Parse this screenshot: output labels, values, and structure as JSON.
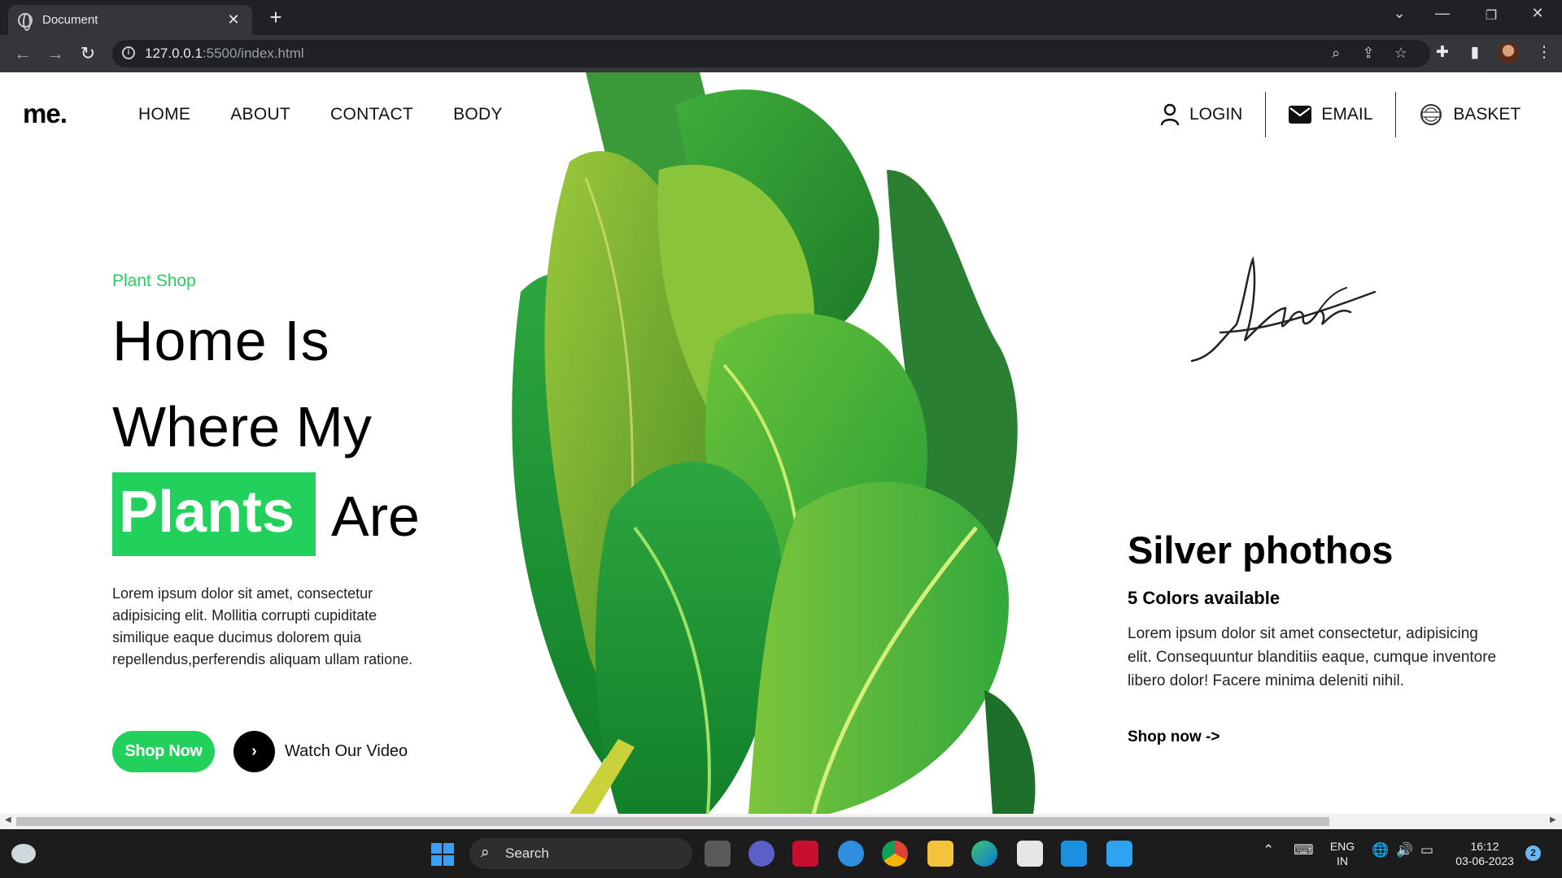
{
  "browser": {
    "tab_title": "Document",
    "tab_close": "✕",
    "new_tab": "+",
    "url_host": "127.0.0.1",
    "url_rest": ":5500/index.html"
  },
  "site": {
    "logo": "me.",
    "nav": [
      "HOME",
      "ABOUT",
      "CONTACT",
      "BODY"
    ],
    "right_nav": {
      "login": "LOGIN",
      "email": "EMAIL",
      "basket": "BASKET"
    },
    "hero": {
      "subtitle": "Plant Shop",
      "line1": "Home Is",
      "line2": "Where My",
      "highlight": "Plants",
      "line3_rest": "Are",
      "description": "Lorem ipsum dolor sit amet, consectetur adipisicing elit. Mollitia corrupti cupiditate similique eaque ducimus dolorem quia repellendus,perferendis aliquam ullam ratione.",
      "shop_button": "Shop Now",
      "play_icon": "›",
      "watch_video": "Watch Our Video"
    },
    "product": {
      "title": "Silver phothos",
      "subtitle": "5 Colors available",
      "description": "Lorem ipsum dolor sit amet consectetur, adipisicing elit. Consequuntur blanditiis eaque, cumque inventore libero dolor! Facere minima deleniti nihil.",
      "link": "Shop now ->"
    },
    "colors": {
      "accent": "#21d15b",
      "text": "#000000"
    }
  },
  "taskbar": {
    "search_label": "Search",
    "lang_top": "ENG",
    "lang_bottom": "IN",
    "time": "16:12",
    "date": "03-06-2023",
    "notifications": "2"
  }
}
